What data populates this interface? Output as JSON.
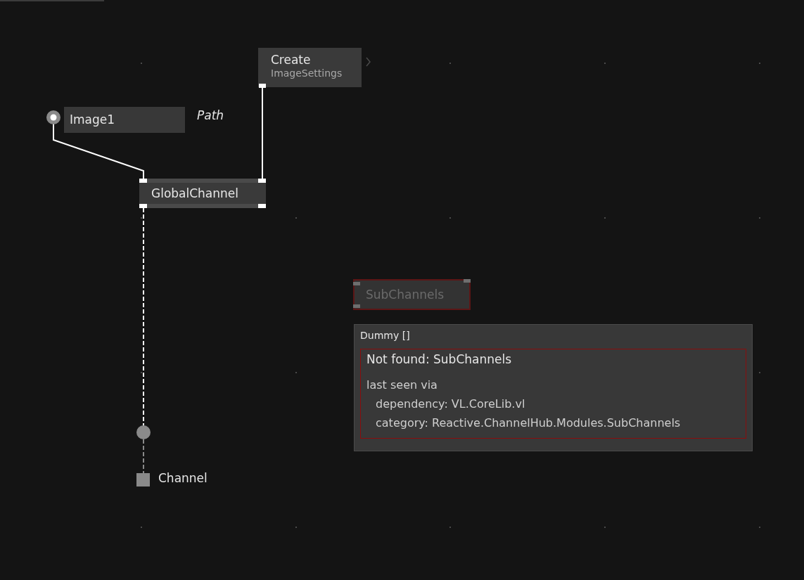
{
  "canvas": {
    "nodes": [
      {
        "kind": "node",
        "title": "Create",
        "subtitle": "ImageSettings",
        "missing": false
      },
      {
        "kind": "iobox",
        "value": "Image1",
        "pin_label": "Path"
      },
      {
        "kind": "node",
        "title": "GlobalChannel",
        "missing": false
      },
      {
        "kind": "node",
        "title": "SubChannels",
        "missing": true
      },
      {
        "kind": "pad",
        "label": "Channel"
      }
    ],
    "tooltip": {
      "title": "Dummy []",
      "error_title": "Not found: SubChannels",
      "lines": [
        {
          "text": "last seen via",
          "indented": false
        },
        {
          "text": "dependency: VL.CoreLib.vl",
          "indented": true
        },
        {
          "text": "category: Reactive.ChannelHub.Modules.SubChannels",
          "indented": true
        }
      ]
    }
  }
}
